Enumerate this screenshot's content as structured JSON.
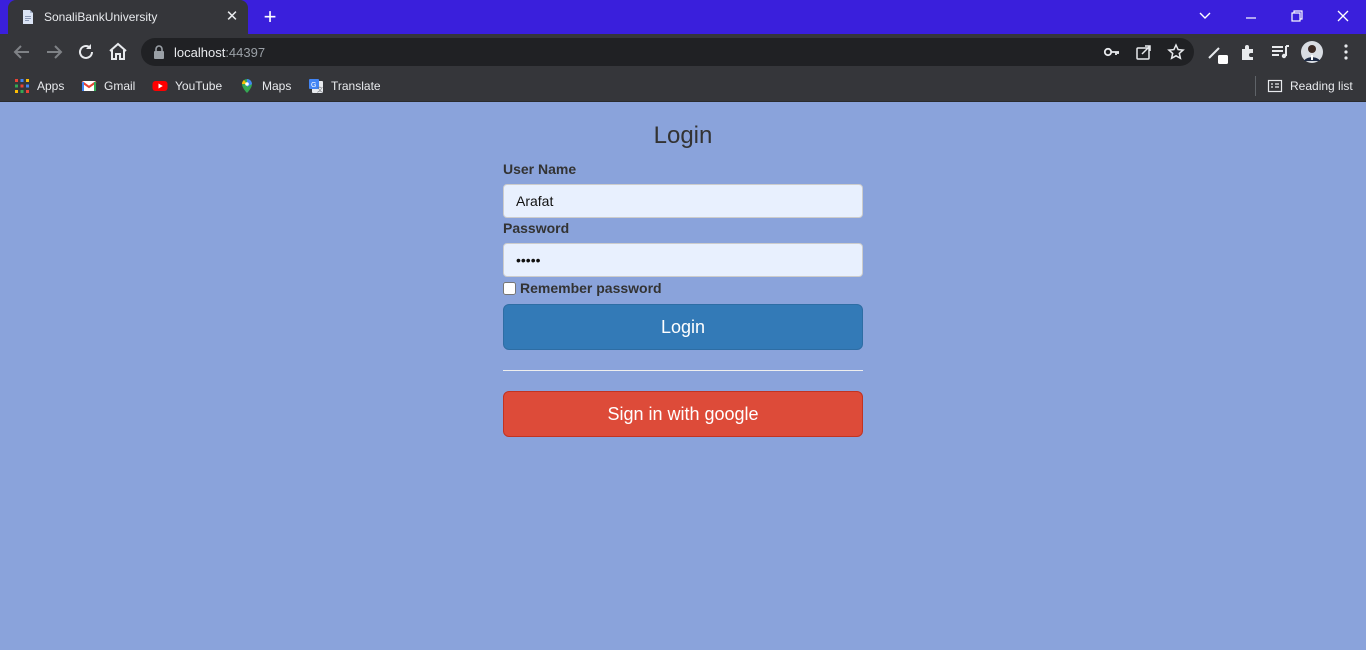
{
  "browser": {
    "tab": {
      "title": "SonaliBankUniversity"
    },
    "address": {
      "host": "localhost",
      "port": ":44397"
    },
    "bookmarks": [
      {
        "label": "Apps",
        "icon": "apps-grid-icon"
      },
      {
        "label": "Gmail",
        "icon": "gmail-icon"
      },
      {
        "label": "YouTube",
        "icon": "youtube-icon"
      },
      {
        "label": "Maps",
        "icon": "maps-icon"
      },
      {
        "label": "Translate",
        "icon": "translate-icon"
      }
    ],
    "reading_list": "Reading list",
    "theme": {
      "titlebar": "#3a1fdc",
      "toolbar": "#35363a"
    }
  },
  "page": {
    "background": "#8aa3db",
    "title": "Login",
    "username": {
      "label": "User Name",
      "value": "Arafat"
    },
    "password": {
      "label": "Password",
      "value": "•••••"
    },
    "remember": {
      "label": "Remember password",
      "checked": false
    },
    "login_button": "Login",
    "google_button": "Sign in with google",
    "colors": {
      "login": "#337ab7",
      "google": "#dd4b39"
    }
  }
}
